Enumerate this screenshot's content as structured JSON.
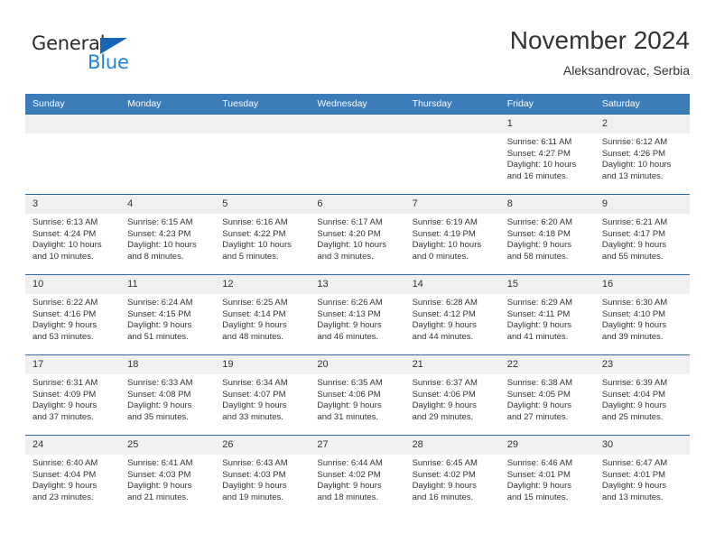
{
  "brand": {
    "name_part1": "General",
    "name_part2": "Blue",
    "triangle_color": "#1567b5",
    "blue_color": "#1f83d8"
  },
  "header": {
    "month_title": "November 2024",
    "location": "Aleksandrovac, Serbia"
  },
  "colors": {
    "header_row_bg": "#3b7cb9",
    "daynum_bg": "#f0f0f0",
    "cell_border": "#2f6ea5",
    "text": "#333333"
  },
  "weekday_headers": [
    "Sunday",
    "Monday",
    "Tuesday",
    "Wednesday",
    "Thursday",
    "Friday",
    "Saturday"
  ],
  "weeks": [
    [
      {
        "day": "",
        "empty": true,
        "sunrise": "",
        "sunset": "",
        "daylight1": "",
        "daylight2": ""
      },
      {
        "day": "",
        "empty": true,
        "sunrise": "",
        "sunset": "",
        "daylight1": "",
        "daylight2": ""
      },
      {
        "day": "",
        "empty": true,
        "sunrise": "",
        "sunset": "",
        "daylight1": "",
        "daylight2": ""
      },
      {
        "day": "",
        "empty": true,
        "sunrise": "",
        "sunset": "",
        "daylight1": "",
        "daylight2": ""
      },
      {
        "day": "",
        "empty": true,
        "sunrise": "",
        "sunset": "",
        "daylight1": "",
        "daylight2": ""
      },
      {
        "day": "1",
        "empty": false,
        "sunrise": "Sunrise: 6:11 AM",
        "sunset": "Sunset: 4:27 PM",
        "daylight1": "Daylight: 10 hours",
        "daylight2": "and 16 minutes."
      },
      {
        "day": "2",
        "empty": false,
        "sunrise": "Sunrise: 6:12 AM",
        "sunset": "Sunset: 4:26 PM",
        "daylight1": "Daylight: 10 hours",
        "daylight2": "and 13 minutes."
      }
    ],
    [
      {
        "day": "3",
        "empty": false,
        "sunrise": "Sunrise: 6:13 AM",
        "sunset": "Sunset: 4:24 PM",
        "daylight1": "Daylight: 10 hours",
        "daylight2": "and 10 minutes."
      },
      {
        "day": "4",
        "empty": false,
        "sunrise": "Sunrise: 6:15 AM",
        "sunset": "Sunset: 4:23 PM",
        "daylight1": "Daylight: 10 hours",
        "daylight2": "and 8 minutes."
      },
      {
        "day": "5",
        "empty": false,
        "sunrise": "Sunrise: 6:16 AM",
        "sunset": "Sunset: 4:22 PM",
        "daylight1": "Daylight: 10 hours",
        "daylight2": "and 5 minutes."
      },
      {
        "day": "6",
        "empty": false,
        "sunrise": "Sunrise: 6:17 AM",
        "sunset": "Sunset: 4:20 PM",
        "daylight1": "Daylight: 10 hours",
        "daylight2": "and 3 minutes."
      },
      {
        "day": "7",
        "empty": false,
        "sunrise": "Sunrise: 6:19 AM",
        "sunset": "Sunset: 4:19 PM",
        "daylight1": "Daylight: 10 hours",
        "daylight2": "and 0 minutes."
      },
      {
        "day": "8",
        "empty": false,
        "sunrise": "Sunrise: 6:20 AM",
        "sunset": "Sunset: 4:18 PM",
        "daylight1": "Daylight: 9 hours",
        "daylight2": "and 58 minutes."
      },
      {
        "day": "9",
        "empty": false,
        "sunrise": "Sunrise: 6:21 AM",
        "sunset": "Sunset: 4:17 PM",
        "daylight1": "Daylight: 9 hours",
        "daylight2": "and 55 minutes."
      }
    ],
    [
      {
        "day": "10",
        "empty": false,
        "sunrise": "Sunrise: 6:22 AM",
        "sunset": "Sunset: 4:16 PM",
        "daylight1": "Daylight: 9 hours",
        "daylight2": "and 53 minutes."
      },
      {
        "day": "11",
        "empty": false,
        "sunrise": "Sunrise: 6:24 AM",
        "sunset": "Sunset: 4:15 PM",
        "daylight1": "Daylight: 9 hours",
        "daylight2": "and 51 minutes."
      },
      {
        "day": "12",
        "empty": false,
        "sunrise": "Sunrise: 6:25 AM",
        "sunset": "Sunset: 4:14 PM",
        "daylight1": "Daylight: 9 hours",
        "daylight2": "and 48 minutes."
      },
      {
        "day": "13",
        "empty": false,
        "sunrise": "Sunrise: 6:26 AM",
        "sunset": "Sunset: 4:13 PM",
        "daylight1": "Daylight: 9 hours",
        "daylight2": "and 46 minutes."
      },
      {
        "day": "14",
        "empty": false,
        "sunrise": "Sunrise: 6:28 AM",
        "sunset": "Sunset: 4:12 PM",
        "daylight1": "Daylight: 9 hours",
        "daylight2": "and 44 minutes."
      },
      {
        "day": "15",
        "empty": false,
        "sunrise": "Sunrise: 6:29 AM",
        "sunset": "Sunset: 4:11 PM",
        "daylight1": "Daylight: 9 hours",
        "daylight2": "and 41 minutes."
      },
      {
        "day": "16",
        "empty": false,
        "sunrise": "Sunrise: 6:30 AM",
        "sunset": "Sunset: 4:10 PM",
        "daylight1": "Daylight: 9 hours",
        "daylight2": "and 39 minutes."
      }
    ],
    [
      {
        "day": "17",
        "empty": false,
        "sunrise": "Sunrise: 6:31 AM",
        "sunset": "Sunset: 4:09 PM",
        "daylight1": "Daylight: 9 hours",
        "daylight2": "and 37 minutes."
      },
      {
        "day": "18",
        "empty": false,
        "sunrise": "Sunrise: 6:33 AM",
        "sunset": "Sunset: 4:08 PM",
        "daylight1": "Daylight: 9 hours",
        "daylight2": "and 35 minutes."
      },
      {
        "day": "19",
        "empty": false,
        "sunrise": "Sunrise: 6:34 AM",
        "sunset": "Sunset: 4:07 PM",
        "daylight1": "Daylight: 9 hours",
        "daylight2": "and 33 minutes."
      },
      {
        "day": "20",
        "empty": false,
        "sunrise": "Sunrise: 6:35 AM",
        "sunset": "Sunset: 4:06 PM",
        "daylight1": "Daylight: 9 hours",
        "daylight2": "and 31 minutes."
      },
      {
        "day": "21",
        "empty": false,
        "sunrise": "Sunrise: 6:37 AM",
        "sunset": "Sunset: 4:06 PM",
        "daylight1": "Daylight: 9 hours",
        "daylight2": "and 29 minutes."
      },
      {
        "day": "22",
        "empty": false,
        "sunrise": "Sunrise: 6:38 AM",
        "sunset": "Sunset: 4:05 PM",
        "daylight1": "Daylight: 9 hours",
        "daylight2": "and 27 minutes."
      },
      {
        "day": "23",
        "empty": false,
        "sunrise": "Sunrise: 6:39 AM",
        "sunset": "Sunset: 4:04 PM",
        "daylight1": "Daylight: 9 hours",
        "daylight2": "and 25 minutes."
      }
    ],
    [
      {
        "day": "24",
        "empty": false,
        "sunrise": "Sunrise: 6:40 AM",
        "sunset": "Sunset: 4:04 PM",
        "daylight1": "Daylight: 9 hours",
        "daylight2": "and 23 minutes."
      },
      {
        "day": "25",
        "empty": false,
        "sunrise": "Sunrise: 6:41 AM",
        "sunset": "Sunset: 4:03 PM",
        "daylight1": "Daylight: 9 hours",
        "daylight2": "and 21 minutes."
      },
      {
        "day": "26",
        "empty": false,
        "sunrise": "Sunrise: 6:43 AM",
        "sunset": "Sunset: 4:03 PM",
        "daylight1": "Daylight: 9 hours",
        "daylight2": "and 19 minutes."
      },
      {
        "day": "27",
        "empty": false,
        "sunrise": "Sunrise: 6:44 AM",
        "sunset": "Sunset: 4:02 PM",
        "daylight1": "Daylight: 9 hours",
        "daylight2": "and 18 minutes."
      },
      {
        "day": "28",
        "empty": false,
        "sunrise": "Sunrise: 6:45 AM",
        "sunset": "Sunset: 4:02 PM",
        "daylight1": "Daylight: 9 hours",
        "daylight2": "and 16 minutes."
      },
      {
        "day": "29",
        "empty": false,
        "sunrise": "Sunrise: 6:46 AM",
        "sunset": "Sunset: 4:01 PM",
        "daylight1": "Daylight: 9 hours",
        "daylight2": "and 15 minutes."
      },
      {
        "day": "30",
        "empty": false,
        "sunrise": "Sunrise: 6:47 AM",
        "sunset": "Sunset: 4:01 PM",
        "daylight1": "Daylight: 9 hours",
        "daylight2": "and 13 minutes."
      }
    ]
  ]
}
